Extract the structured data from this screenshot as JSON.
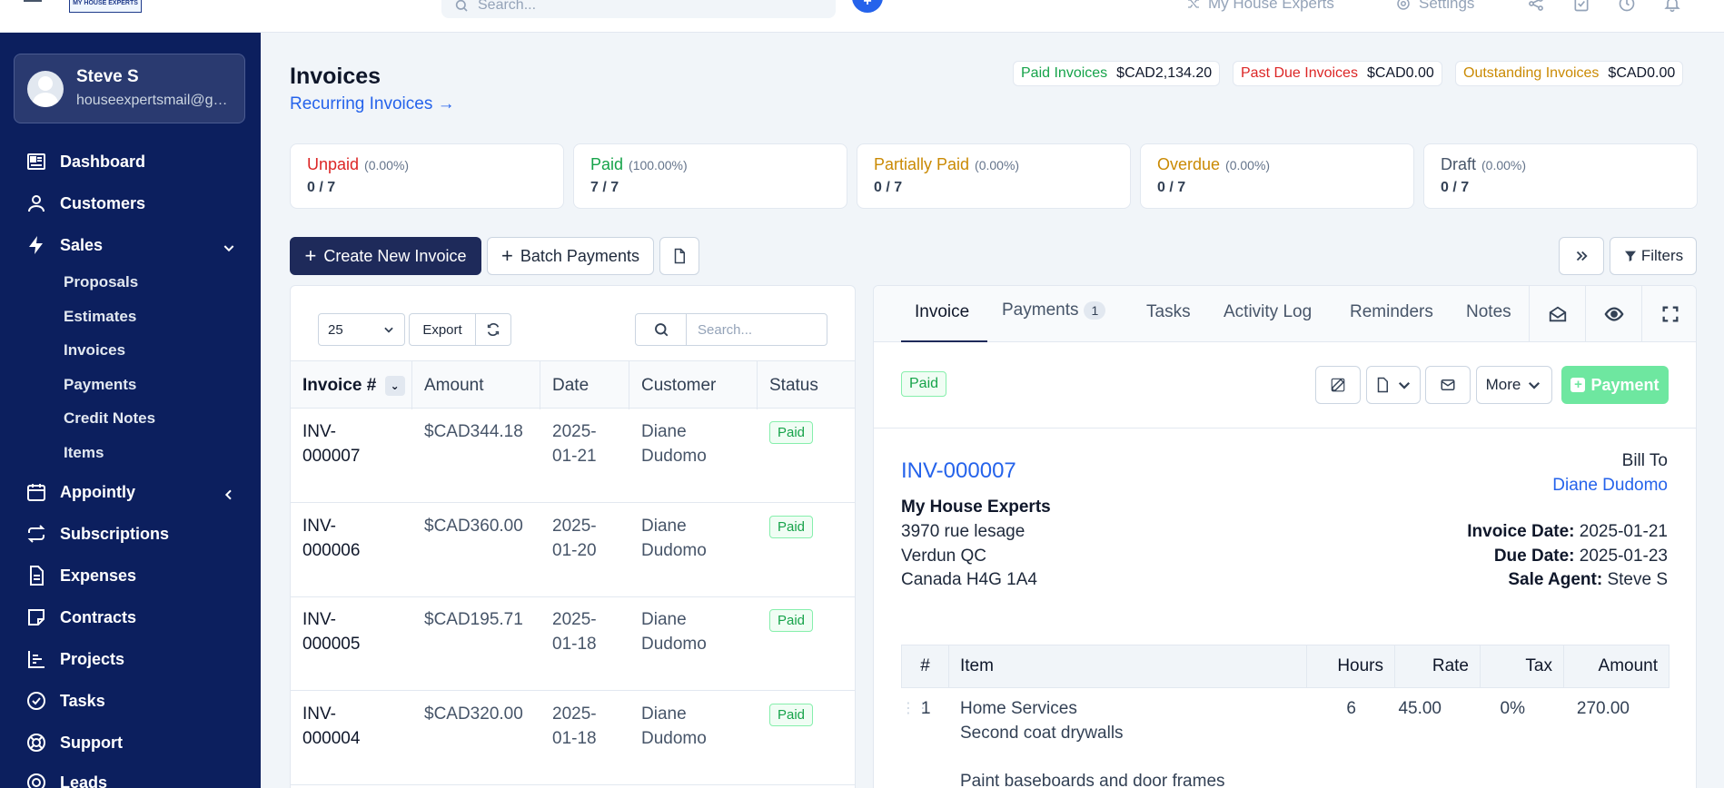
{
  "topbar": {
    "logo_text": "MY HOUSE EXPERTS",
    "search_placeholder": "Search...",
    "company_link": "My House Experts",
    "settings_link": "Settings"
  },
  "sidebar": {
    "user": {
      "name": "Steve S",
      "email": "houseexpertsmail@gmail.com"
    },
    "items": [
      {
        "label": "Dashboard",
        "icon": "dashboard-icon"
      },
      {
        "label": "Customers",
        "icon": "user-icon"
      },
      {
        "label": "Sales",
        "icon": "bolt-icon"
      },
      {
        "label": "Appointly",
        "icon": "calendar-icon"
      },
      {
        "label": "Subscriptions",
        "icon": "repeat-icon"
      },
      {
        "label": "Expenses",
        "icon": "file-icon"
      },
      {
        "label": "Contracts",
        "icon": "note-icon"
      },
      {
        "label": "Projects",
        "icon": "chart-icon"
      },
      {
        "label": "Tasks",
        "icon": "check-circle-icon"
      },
      {
        "label": "Support",
        "icon": "lifebuoy-icon"
      },
      {
        "label": "Leads",
        "icon": "target-icon"
      }
    ],
    "sales_sub": [
      "Proposals",
      "Estimates",
      "Invoices",
      "Payments",
      "Credit Notes",
      "Items"
    ]
  },
  "page": {
    "title": "Invoices",
    "recurring_link": "Recurring Invoices →"
  },
  "summary": [
    {
      "label": "Paid Invoices",
      "value": "$CAD2,134.20",
      "color": "#16a34a"
    },
    {
      "label": "Past Due Invoices",
      "value": "$CAD0.00",
      "color": "#dc2626"
    },
    {
      "label": "Outstanding Invoices",
      "value": "$CAD0.00",
      "color": "#ca8a04"
    }
  ],
  "stats": [
    {
      "label": "Unpaid",
      "pct": "(0.00%)",
      "count": "0 / 7",
      "color": "#dc2626"
    },
    {
      "label": "Paid",
      "pct": "(100.00%)",
      "count": "7 / 7",
      "color": "#16a34a"
    },
    {
      "label": "Partially Paid",
      "pct": "(0.00%)",
      "count": "0 / 7",
      "color": "#ca8a04"
    },
    {
      "label": "Overdue",
      "pct": "(0.00%)",
      "count": "0 / 7",
      "color": "#ca8a04"
    },
    {
      "label": "Draft",
      "pct": "(0.00%)",
      "count": "0 / 7",
      "color": "#475569"
    }
  ],
  "actions": {
    "create": "Create New Invoice",
    "batch": "Batch Payments",
    "filters": "Filters"
  },
  "table": {
    "page_size": "25",
    "export": "Export",
    "search_placeholder": "Search...",
    "headers": [
      "Invoice #",
      "Amount",
      "Date",
      "Customer",
      "Status"
    ],
    "rows": [
      {
        "inv1": "INV-",
        "inv2": "000007",
        "amount": "$CAD344.18",
        "date1": "2025-",
        "date2": "01-21",
        "cust1": "Diane",
        "cust2": "Dudomo",
        "status": "Paid"
      },
      {
        "inv1": "INV-",
        "inv2": "000006",
        "amount": "$CAD360.00",
        "date1": "2025-",
        "date2": "01-20",
        "cust1": "Diane",
        "cust2": "Dudomo",
        "status": "Paid"
      },
      {
        "inv1": "INV-",
        "inv2": "000005",
        "amount": "$CAD195.71",
        "date1": "2025-",
        "date2": "01-18",
        "cust1": "Diane",
        "cust2": "Dudomo",
        "status": "Paid"
      },
      {
        "inv1": "INV-",
        "inv2": "000004",
        "amount": "$CAD320.00",
        "date1": "2025-",
        "date2": "01-18",
        "cust1": "Diane",
        "cust2": "Dudomo",
        "status": "Paid"
      }
    ]
  },
  "detail": {
    "tabs": [
      "Invoice",
      "Payments",
      "Tasks",
      "Activity Log",
      "Reminders",
      "Notes"
    ],
    "payments_count": "1",
    "status": "Paid",
    "more": "More",
    "payment_btn": "Payment",
    "invoice_number": "INV-000007",
    "company": "My House Experts",
    "address1": "3970 rue lesage",
    "address2": "Verdun QC",
    "address3": "Canada H4G 1A4",
    "bill_to_label": "Bill To",
    "bill_to": "Diane Dudomo",
    "invoice_date_label": "Invoice Date:",
    "invoice_date": "2025-01-21",
    "due_date_label": "Due Date:",
    "due_date": "2025-01-23",
    "agent_label": "Sale Agent:",
    "agent": "Steve S",
    "items_headers": [
      "#",
      "Item",
      "Hours",
      "Rate",
      "Tax",
      "Amount"
    ],
    "item": {
      "num": "1",
      "name": "Home Services",
      "desc1": "Second coat drywalls",
      "desc2": "Paint baseboards and door frames",
      "hours": "6",
      "rate": "45.00",
      "tax": "0%",
      "amount": "270.00"
    }
  }
}
